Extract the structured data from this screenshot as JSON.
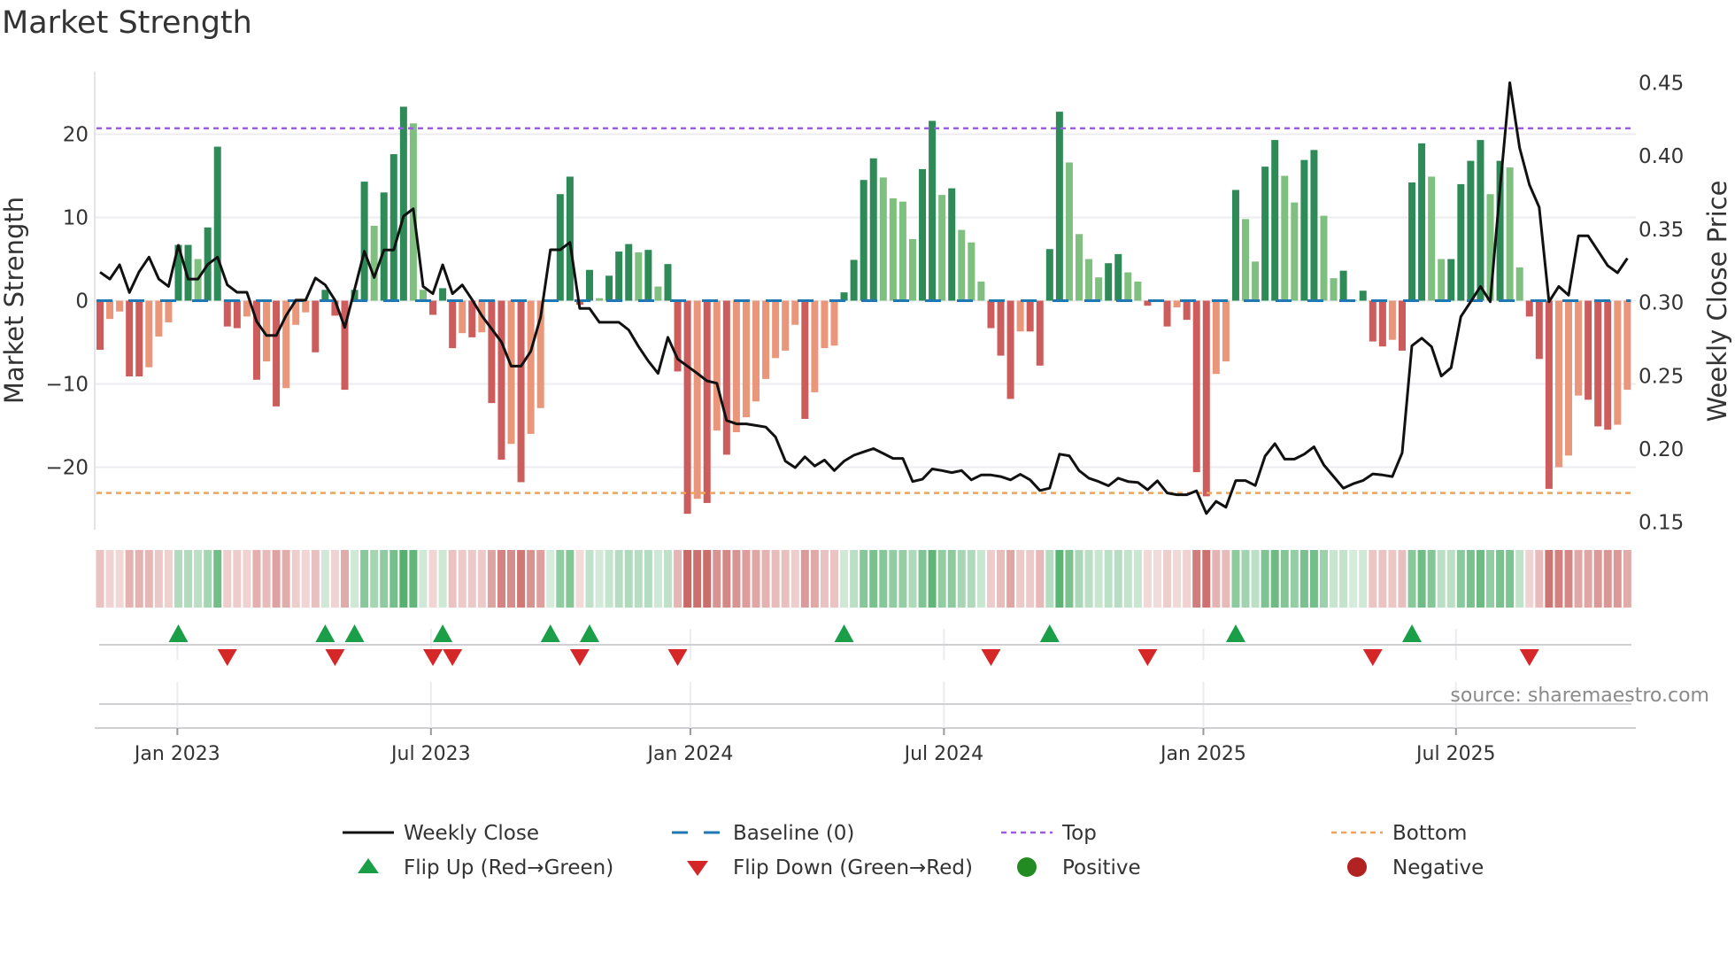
{
  "title": "Market Strength",
  "source": "source: sharemaestro.com",
  "colors": {
    "pos_strong": "#2e8b57",
    "pos_weak": "#7fbf7f",
    "neg_strong": "#cd5c5c",
    "neg_weak": "#e9967a",
    "strip_pos": "#2f9e4f",
    "strip_neg": "#c0504d",
    "flip_up": "#1a9e48",
    "flip_down": "#d62728",
    "top": "#9b5de5",
    "bottom": "#f0a35a",
    "baseline": "#1f77b4",
    "line": "#111111",
    "legend_positive": "#228b22",
    "legend_negative": "#b22222"
  },
  "legend": [
    {
      "label": "Weekly Close",
      "icon": "line-solid"
    },
    {
      "label": "Baseline (0)",
      "icon": "line-dashed"
    },
    {
      "label": "Top",
      "icon": "line-dotted-purple"
    },
    {
      "label": "Bottom",
      "icon": "line-dotted-orange"
    },
    {
      "label": "Flip Up (Red→Green)",
      "icon": "triangle-up"
    },
    {
      "label": "Flip Down (Green→Red)",
      "icon": "triangle-down"
    },
    {
      "label": "Positive",
      "icon": "dot-green"
    },
    {
      "label": "Negative",
      "icon": "dot-red"
    }
  ],
  "chart_data": {
    "type": "bar",
    "title": "Market Strength",
    "ylabel": "Market Strength",
    "y2label": "Weekly Close Price",
    "ylim": [
      -27.5,
      27.5
    ],
    "y2lim": [
      0.145,
      0.4575
    ],
    "yticks": [
      {
        "value": 20,
        "label": "20"
      },
      {
        "value": 10,
        "label": "10"
      },
      {
        "value": 0,
        "label": "0"
      },
      {
        "value": -10,
        "label": "−10"
      },
      {
        "value": -20,
        "label": "−20"
      }
    ],
    "y2ticks": [
      {
        "value": 0.45,
        "label": "0.45"
      },
      {
        "value": 0.4,
        "label": "0.40"
      },
      {
        "value": 0.35,
        "label": "0.35"
      },
      {
        "value": 0.3,
        "label": "0.30"
      },
      {
        "value": 0.25,
        "label": "0.25"
      },
      {
        "value": 0.2,
        "label": "0.20"
      },
      {
        "value": 0.15,
        "label": "0.15"
      }
    ],
    "xticks": [
      {
        "week": 8.9,
        "label": "Jan 2023"
      },
      {
        "week": 34.8,
        "label": "Jul 2023"
      },
      {
        "week": 61.3,
        "label": "Jan 2024"
      },
      {
        "week": 87.2,
        "label": "Jul 2024"
      },
      {
        "week": 113.7,
        "label": "Jan 2025"
      },
      {
        "week": 139.5,
        "label": "Jul 2025"
      }
    ],
    "top": 20.7,
    "bottom": -23.1,
    "baseline": 0,
    "strength": [
      -5.9,
      -2.2,
      -1.3,
      -9.1,
      -9.1,
      -8,
      -4.3,
      -2.6,
      6.7,
      6.7,
      5,
      8.8,
      18.5,
      -3.1,
      -3.3,
      -1.9,
      -9.5,
      -7.3,
      -12.7,
      -10.5,
      -2.9,
      -1.4,
      -6.2,
      1.3,
      -1.8,
      -10.7,
      1.3,
      14.3,
      9,
      13,
      17.6,
      23.3,
      21.3,
      1.3,
      -1.7,
      1.5,
      -5.7,
      -3.9,
      -4.4,
      -3.8,
      -12.3,
      -19.1,
      -17.2,
      -21.8,
      -16,
      -12.9,
      0.1,
      12.8,
      14.9,
      -0.5,
      3.7,
      0.3,
      3,
      5.9,
      6.8,
      5.8,
      6.1,
      1.7,
      4.4,
      -8.5,
      -25.6,
      -23.8,
      -24.3,
      -15.6,
      -18.5,
      -15.8,
      -14,
      -12.1,
      -9.4,
      -6.9,
      -6,
      -2.9,
      -14.2,
      -11,
      -5.7,
      -5.4,
      1,
      4.9,
      14.5,
      17.1,
      14.8,
      12.3,
      11.9,
      7.4,
      15.8,
      21.6,
      12.7,
      13.5,
      8.5,
      7,
      2.3,
      -3.3,
      -6.6,
      -11.8,
      -3.7,
      -3.7,
      -7.8,
      6.2,
      22.7,
      16.6,
      8,
      5,
      2.8,
      4.5,
      5.6,
      3.4,
      2.3,
      -0.6,
      -0.1,
      -3.1,
      -0.8,
      -2.3,
      -20.6,
      -23.5,
      -8.8,
      -7.3,
      13.3,
      9.8,
      4.7,
      16.1,
      19.3,
      15,
      11.8,
      16.9,
      18.1,
      10.2,
      2.7,
      3.6,
      0.1,
      1.2,
      -4.9,
      -5.5,
      -4.7,
      -6,
      14.2,
      18.9,
      14.9,
      5,
      5,
      14,
      16.8,
      19.3,
      12.8,
      16.8,
      16,
      4,
      -1.9,
      -7,
      -22.6,
      -20,
      -18.6,
      -11.4,
      -11.9,
      -15.1,
      -15.5,
      -14.9,
      -10.7
    ],
    "weekly_close": [
      0.3207,
      0.316,
      0.3257,
      0.3068,
      0.321,
      0.331,
      0.316,
      0.311,
      0.339,
      0.316,
      0.316,
      0.326,
      0.331,
      0.312,
      0.307,
      0.307,
      0.287,
      0.2775,
      0.2775,
      0.291,
      0.3016,
      0.3016,
      0.3167,
      0.312,
      0.3016,
      0.283,
      0.309,
      0.335,
      0.317,
      0.3358,
      0.3358,
      0.359,
      0.364,
      0.311,
      0.306,
      0.3257,
      0.306,
      0.312,
      0.302,
      0.291,
      0.282,
      0.273,
      0.2566,
      0.2566,
      0.2667,
      0.29,
      0.336,
      0.336,
      0.341,
      0.296,
      0.296,
      0.2865,
      0.2865,
      0.2865,
      0.2813,
      0.27,
      0.26,
      0.2516,
      0.2762,
      0.2615,
      0.2566,
      0.2516,
      0.2465,
      0.2449,
      0.2195,
      0.2172,
      0.2172,
      0.2161,
      0.215,
      0.2082,
      0.1918,
      0.1873,
      0.1947,
      0.1884,
      0.1925,
      0.1853,
      0.1918,
      0.1958,
      0.1981,
      0.2003,
      0.197,
      0.1936,
      0.1936,
      0.1778,
      0.1794,
      0.1864,
      0.1853,
      0.1839,
      0.1853,
      0.179,
      0.1823,
      0.1823,
      0.1812,
      0.179,
      0.1828,
      0.179,
      0.1717,
      0.1733,
      0.1965,
      0.1954,
      0.1853,
      0.1801,
      0.1778,
      0.1749,
      0.1801,
      0.1778,
      0.1772,
      0.1722,
      0.1783,
      0.17,
      0.1688,
      0.1688,
      0.1715,
      0.156,
      0.1643,
      0.1603,
      0.1785,
      0.1785,
      0.1751,
      0.1951,
      0.2037,
      0.1931,
      0.1931,
      0.1965,
      0.2015,
      0.1891,
      0.1812,
      0.1733,
      0.1763,
      0.1785,
      0.183,
      0.1823,
      0.1812,
      0.1974,
      0.2705,
      0.2757,
      0.2698,
      0.2498,
      0.2555,
      0.2903,
      0.3005,
      0.311,
      0.3005,
      0.378,
      0.45,
      0.4055,
      0.3803,
      0.365,
      0.3005,
      0.311,
      0.305,
      0.3455,
      0.3455,
      0.3353,
      0.3252,
      0.3203,
      0.3302
    ]
  }
}
